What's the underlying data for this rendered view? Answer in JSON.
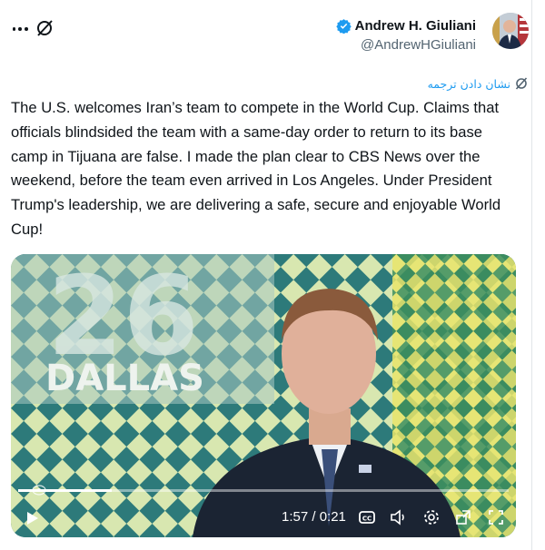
{
  "author": {
    "name": "Andrew H. Giuliani",
    "handle": "@AndrewHGiuliani"
  },
  "translate": {
    "label": "نشان دادن ترجمه"
  },
  "tweet": {
    "text": "The U.S. welcomes Iran’s team to compete in the World Cup. Claims that officials blindsided the team with a same-day order to return to its base camp in Tijuana are false. I made the plan clear to CBS News over the weekend, before the team even arrived in Los Angeles. Under President Trump's leadership, we are delivering a safe, secure and enjoyable World Cup!"
  },
  "video": {
    "time": "1:57 / 0:21",
    "progress": 0.19,
    "background_text": "DALLAS",
    "background_number": "26"
  },
  "colors": {
    "accent": "#1d9bf0",
    "text": "#0f1419",
    "muted": "#536471"
  },
  "icons": [
    "more-icon",
    "grok-icon",
    "verified-badge-icon",
    "translate-icon",
    "play-icon",
    "captions-icon",
    "volume-icon",
    "settings-icon",
    "pip-icon",
    "fullscreen-icon"
  ]
}
